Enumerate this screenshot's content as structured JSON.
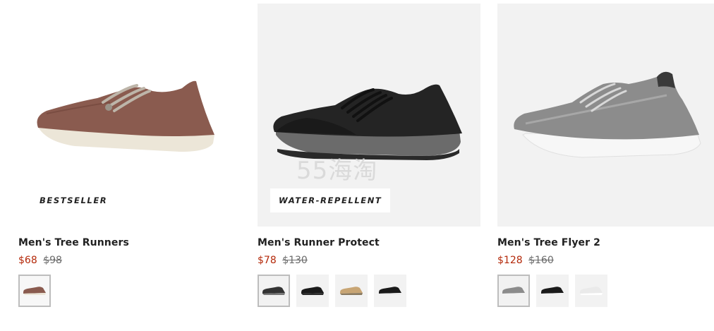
{
  "products": [
    {
      "title": "Men's Tree Runners",
      "price_now": "$68",
      "price_was": "$98",
      "badge": "BESTSELLER",
      "swatches": [
        "brown",
        "",
        "",
        ""
      ]
    },
    {
      "title": "Men's Runner Protect",
      "price_now": "$78",
      "price_was": "$130",
      "badge": "WATER-REPELLENT",
      "swatches": [
        "dark grey",
        "black",
        "tan",
        "black white sole"
      ]
    },
    {
      "title": "Men's Tree Flyer 2",
      "price_now": "$128",
      "price_was": "$160",
      "badge": "",
      "swatches": [
        "grey",
        "black",
        "white"
      ]
    }
  ],
  "watermark": "55海淘",
  "colors": {
    "price_now": "#b4290a",
    "price_was": "#6b6b6b",
    "image_bg": "#f2f2f2"
  }
}
